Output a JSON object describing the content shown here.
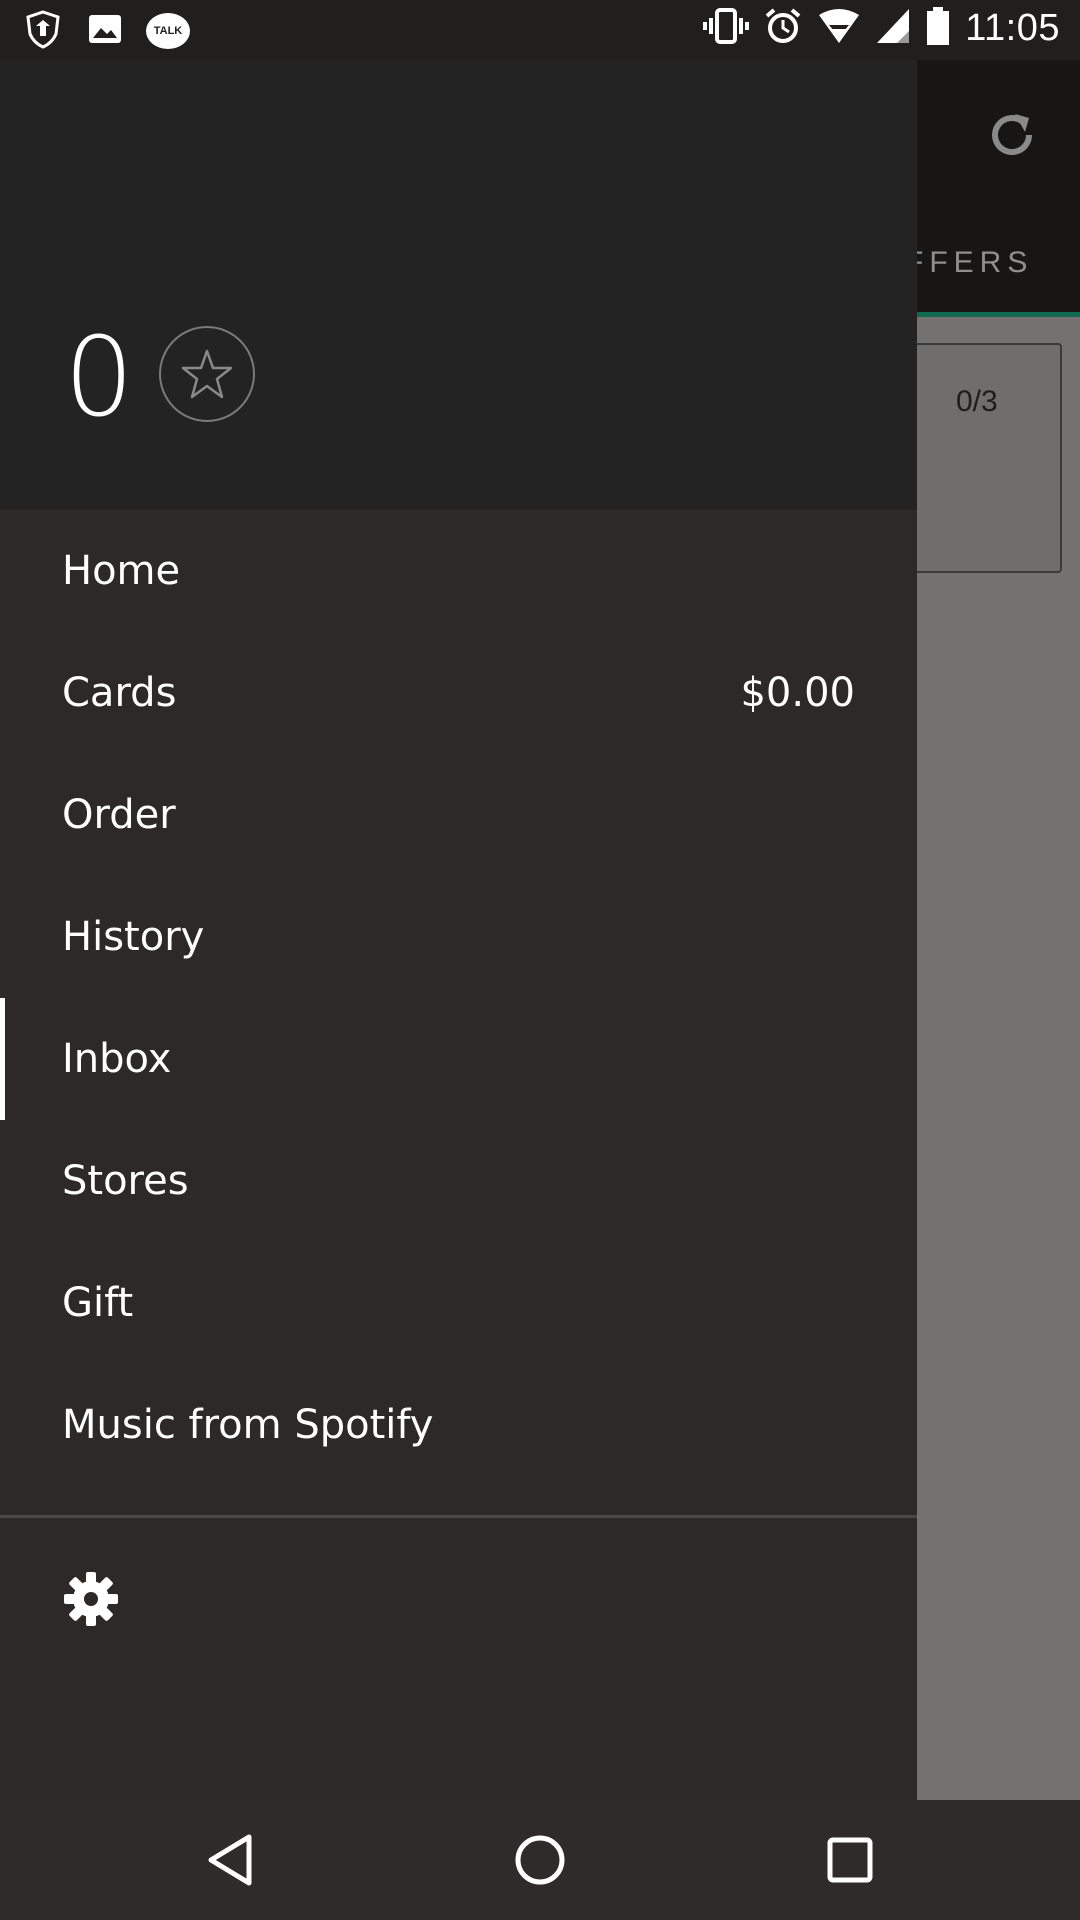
{
  "status_bar": {
    "time": "11:05",
    "left_icons": [
      "shield-icon",
      "image-icon",
      "talk-icon"
    ],
    "talk_label": "TALK",
    "right_icons": [
      "vibrate-icon",
      "alarm-icon",
      "wifi-icon",
      "signal-icon",
      "battery-icon"
    ]
  },
  "background_app": {
    "tab_label": "FFERS",
    "card_count": "0/3",
    "refresh_icon": "refresh-icon"
  },
  "drawer": {
    "rewards_count": "0",
    "star_icon": "star-icon",
    "menu": [
      {
        "label": "Home"
      },
      {
        "label": "Cards",
        "value": "$0.00"
      },
      {
        "label": "Order"
      },
      {
        "label": "History"
      },
      {
        "label": "Inbox",
        "active": true
      },
      {
        "label": "Stores"
      },
      {
        "label": "Gift"
      },
      {
        "label": "Music from Spotify"
      }
    ],
    "settings_icon": "gear-icon"
  },
  "nav_bar": {
    "buttons": [
      "back-icon",
      "home-icon",
      "recents-icon"
    ]
  },
  "colors": {
    "drawer_bg": "#2c2927",
    "header_bg": "#232323",
    "accent_green": "#0f6a4f",
    "text": "#ffffff"
  }
}
